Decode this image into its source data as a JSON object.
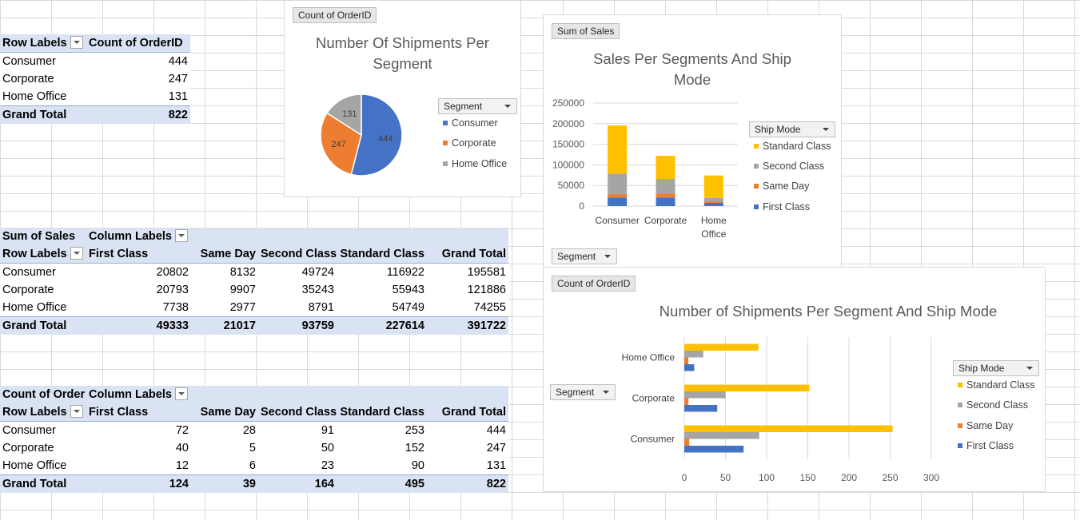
{
  "pivot_segment": {
    "headers": [
      "Row Labels",
      "Count of OrderID"
    ],
    "rows": [
      {
        "label": "Consumer",
        "value": "444"
      },
      {
        "label": "Corporate",
        "value": "247"
      },
      {
        "label": "Home Office",
        "value": "131"
      }
    ],
    "total": {
      "label": "Grand Total",
      "value": "822"
    }
  },
  "pivot_sales": {
    "value_field": "Sum of Sales",
    "column_labels": "Column Labels",
    "row_labels": "Row Labels",
    "columns": [
      "First Class",
      "Same Day",
      "Second Class",
      "Standard Class",
      "Grand Total"
    ],
    "rows": [
      {
        "label": "Consumer",
        "values": [
          "20802",
          "8132",
          "49724",
          "116922",
          "195581"
        ]
      },
      {
        "label": "Corporate",
        "values": [
          "20793",
          "9907",
          "35243",
          "55943",
          "121886"
        ]
      },
      {
        "label": "Home Office",
        "values": [
          "7738",
          "2977",
          "8791",
          "54749",
          "74255"
        ]
      }
    ],
    "total": {
      "label": "Grand Total",
      "values": [
        "49333",
        "21017",
        "93759",
        "227614",
        "391722"
      ]
    }
  },
  "pivot_count": {
    "value_field": "Count of Order",
    "column_labels": "Column Labels",
    "row_labels": "Row Labels",
    "columns": [
      "First Class",
      "Same Day",
      "Second Class",
      "Standard Class",
      "Grand Total"
    ],
    "rows": [
      {
        "label": "Consumer",
        "values": [
          "72",
          "28",
          "91",
          "253",
          "444"
        ]
      },
      {
        "label": "Corporate",
        "values": [
          "40",
          "5",
          "50",
          "152",
          "247"
        ]
      },
      {
        "label": "Home Office",
        "values": [
          "12",
          "6",
          "23",
          "90",
          "131"
        ]
      }
    ],
    "total": {
      "label": "Grand Total",
      "values": [
        "124",
        "39",
        "164",
        "495",
        "822"
      ]
    }
  },
  "colors": {
    "standard": "#ffc000",
    "second": "#a5a5a5",
    "same_day": "#ed7d31",
    "first": "#4472c4",
    "pie_consumer": "#4472c4",
    "pie_corporate": "#ed7d31",
    "pie_home": "#a5a5a5"
  },
  "chart_data": [
    {
      "type": "pie",
      "field_button": "Count of OrderID",
      "title": "Number Of Shipments Per Segment",
      "legend_button": "Segment",
      "labels": [
        "Consumer",
        "Corporate",
        "Home Office"
      ],
      "values": [
        444,
        247,
        131
      ],
      "data_labels": [
        "444",
        "247",
        "131"
      ],
      "legend_position": "right"
    },
    {
      "type": "bar",
      "stacked": true,
      "orientation": "vertical",
      "field_button": "Sum of Sales",
      "title": "Sales Per Segments And Ship Mode",
      "legend_button": "Ship Mode",
      "axis_button": "Segment",
      "categories": [
        "Consumer",
        "Corporate",
        "Home Office"
      ],
      "series": [
        {
          "name": "Standard Class",
          "values": [
            116922,
            55943,
            54749
          ]
        },
        {
          "name": "Second Class",
          "values": [
            49724,
            35243,
            8791
          ]
        },
        {
          "name": "Same Day",
          "values": [
            8132,
            9907,
            2977
          ]
        },
        {
          "name": "First Class",
          "values": [
            20802,
            20793,
            7738
          ]
        }
      ],
      "ylim": [
        0,
        250000
      ],
      "yticks": [
        "250000",
        "200000",
        "150000",
        "100000",
        "50000",
        "0"
      ],
      "legend_position": "right",
      "grid": true
    },
    {
      "type": "bar",
      "stacked": false,
      "orientation": "horizontal",
      "field_button": "Count of OrderID",
      "title": "Number of Shipments Per Segment And Ship Mode",
      "legend_button": "Ship Mode",
      "axis_button": "Segment",
      "categories": [
        "Consumer",
        "Corporate",
        "Home Office"
      ],
      "series": [
        {
          "name": "Standard Class",
          "values": [
            253,
            152,
            90
          ]
        },
        {
          "name": "Second Class",
          "values": [
            91,
            50,
            23
          ]
        },
        {
          "name": "Same Day",
          "values": [
            6,
            5,
            5
          ]
        },
        {
          "name": "First Class",
          "values": [
            72,
            40,
            12
          ]
        }
      ],
      "xlim": [
        0,
        300
      ],
      "xticks": [
        "0",
        "50",
        "100",
        "150",
        "200",
        "250",
        "300"
      ],
      "legend_position": "right",
      "grid": true
    }
  ]
}
